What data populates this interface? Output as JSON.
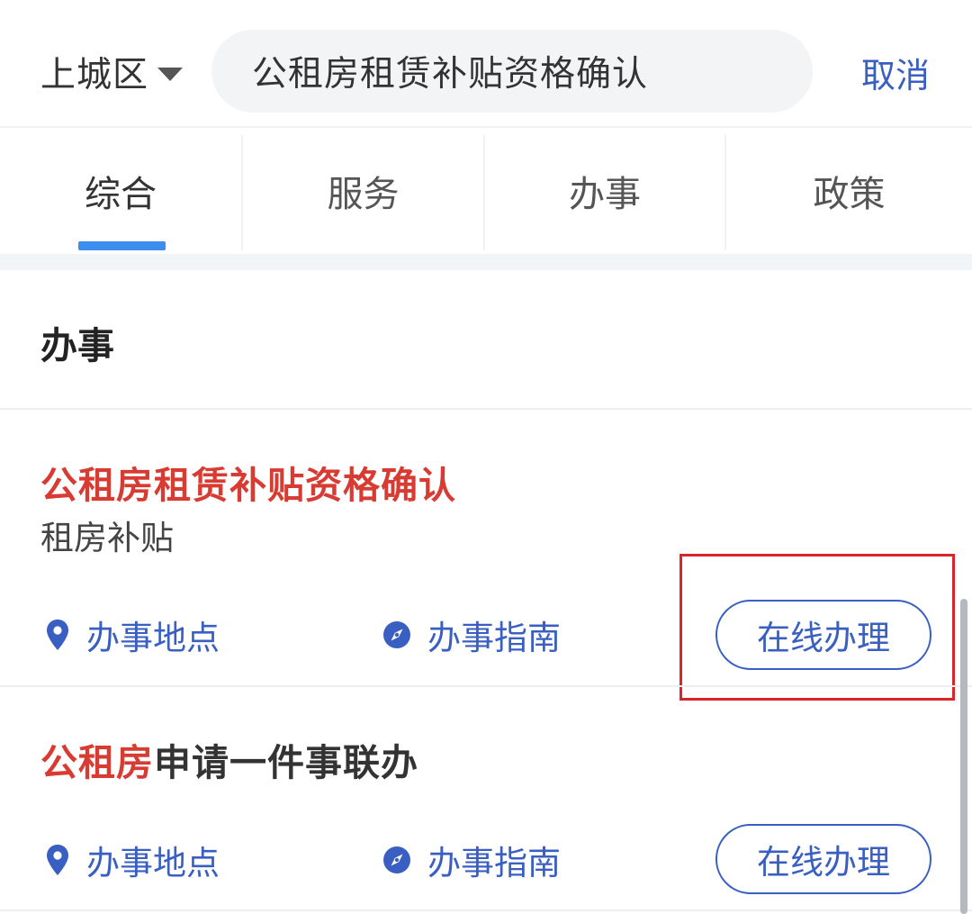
{
  "header": {
    "region": "上城区",
    "search_value": "公租房租赁补贴资格确认",
    "cancel_label": "取消"
  },
  "tabs": [
    {
      "label": "综合",
      "active": true
    },
    {
      "label": "服务",
      "active": false
    },
    {
      "label": "办事",
      "active": false
    },
    {
      "label": "政策",
      "active": false
    }
  ],
  "section": {
    "title": "办事"
  },
  "items": [
    {
      "title_highlight": "公租房租赁补贴资格确认",
      "title_rest": "",
      "subtitle": "租房补贴",
      "location_label": "办事地点",
      "guide_label": "办事指南",
      "online_label": "在线办理"
    },
    {
      "title_highlight": "公租房",
      "title_rest": "申请一件事联办",
      "subtitle": "",
      "location_label": "办事地点",
      "guide_label": "办事指南",
      "online_label": "在线办理"
    }
  ],
  "colors": {
    "accent_blue": "#3a5fc3",
    "highlight_red": "#d83b32",
    "tab_indicator": "#3b8ef0",
    "annotation_box": "#d9242b"
  },
  "icons": {
    "location": "map-pin-icon",
    "guide": "compass-icon",
    "region_caret": "caret-down-icon"
  }
}
